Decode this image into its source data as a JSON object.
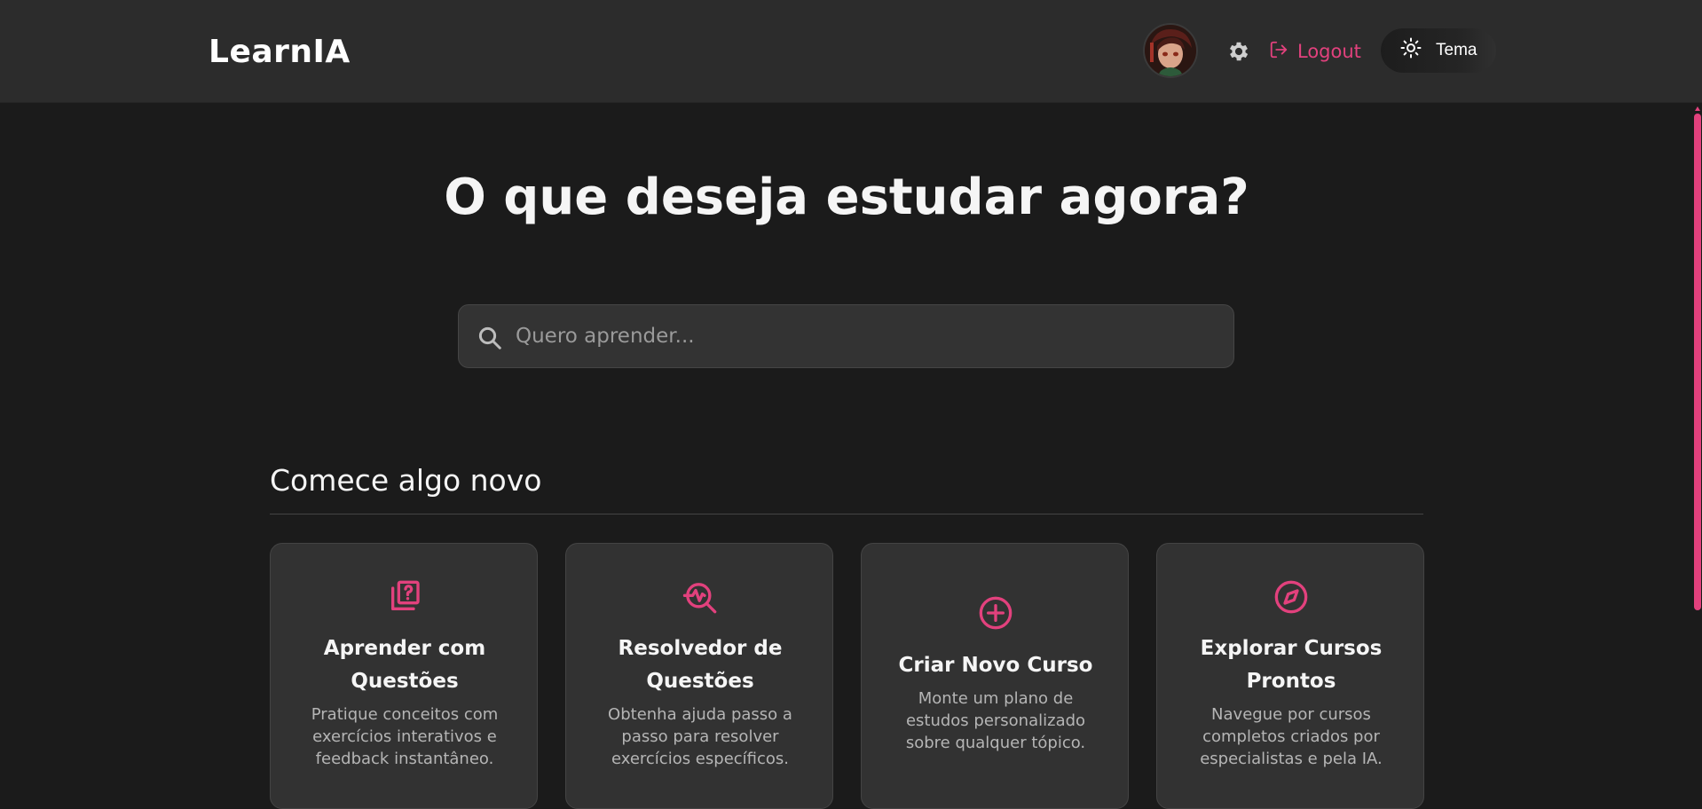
{
  "header": {
    "brand": "LearnIA",
    "logout_label": "Logout",
    "theme_label": "Tema"
  },
  "main": {
    "title": "O que deseja estudar agora?",
    "search": {
      "placeholder": "Quero aprender...",
      "value": ""
    },
    "section_title": "Comece algo novo",
    "cards": [
      {
        "icon": "question-book-icon",
        "title": "Aprender com Questões",
        "description": "Pratique conceitos com exercícios interativos e feedback instantâneo."
      },
      {
        "icon": "search-pulse-icon",
        "title": "Resolvedor de Questões",
        "description": "Obtenha ajuda passo a passo para resolver exercícios específicos."
      },
      {
        "icon": "plus-circle-icon",
        "title": "Criar Novo Curso",
        "description": "Monte um plano de estudos personalizado sobre qualquer tópico."
      },
      {
        "icon": "compass-icon",
        "title": "Explorar Cursos Prontos",
        "description": "Navegue por cursos completos criados por especialistas e pela IA."
      }
    ]
  },
  "colors": {
    "accent": "#e2417d",
    "background": "#1b1b1b",
    "header_background": "#2c2c2c",
    "card_background": "#323232"
  }
}
